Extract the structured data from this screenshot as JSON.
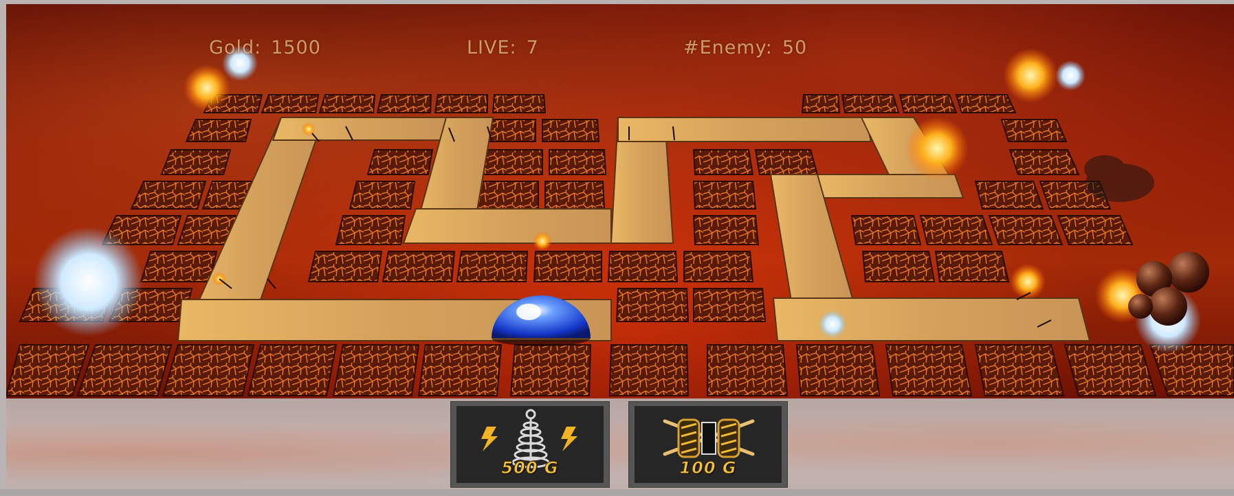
{
  "hud": {
    "gold_label": "Gold:",
    "gold_value": "1500",
    "lives_label": "LIVE:",
    "lives_value": "7",
    "enemy_label": "#Enemy:",
    "enemy_value": "50"
  },
  "shop": {
    "towers": [
      {
        "icon": "tesla-tower-icon",
        "price": "500 G"
      },
      {
        "icon": "barrier-wall-icon",
        "price": "100 G"
      }
    ]
  },
  "colors": {
    "lava": "#a32a08",
    "tile_crack": "#f07a1e",
    "path_wood": "#d9a760",
    "hud_text": "#e6be82",
    "price_text": "#f0c240"
  }
}
